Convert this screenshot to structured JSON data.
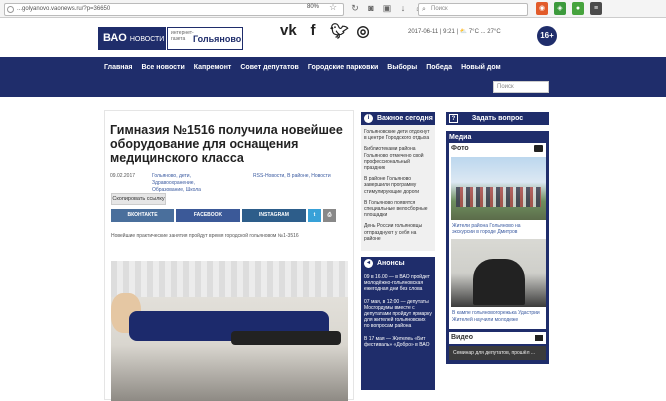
{
  "browser": {
    "url": "...golyanovo.vaonews.ru/?p=36650",
    "zoom": "80%",
    "search_placeholder": "Поиск",
    "star": "☆"
  },
  "header": {
    "logo_main": "ВАО",
    "logo_small": "НОВОСТИ",
    "logo_tiny": "интернет-газета",
    "logo_district": "Гольяново",
    "date_weather": "2017-06-11 | 9:21 | ⛅ 7°C ... 27°C",
    "age_rating": "16+"
  },
  "nav": {
    "items": [
      "Главная",
      "Все новости",
      "Капремонт",
      "Совет депутатов",
      "Городские парковки",
      "Выборы",
      "Победа",
      "Новый дом"
    ],
    "search_placeholder": "Поиск"
  },
  "article": {
    "title": "Гимназия №1516 получила новейшее оборудование для оснащения медицинского класса",
    "date": "09.02.2017",
    "tags": "Гольяново, дети, Здравоохранение, Образование, Школа",
    "links": "RSS-Новости, В районе, Новости",
    "copy_button": "Скопировать ссылку",
    "share": {
      "vk": "ВКОНТАКТЕ",
      "fb": "FACEBOOK",
      "ig": "INSTAGRAM"
    },
    "caption": "Новейшие практические занятия пройдут время городской гольяновом №1-3516"
  },
  "important": {
    "title": "Важное сегодня",
    "items": [
      "Гольяновские дети отдохнут в центре Городского отдыха",
      "Библиотеками района Гольяново отмечено свой профессиональный праздник",
      "В районе Гольяново завершили программу стимулирующие дороги",
      "В Гольяново появятся специальные велосборные площадки",
      "День России гольяновцы отпразднуют у себя на районе"
    ]
  },
  "announcements": {
    "title": "Анонсы",
    "items": [
      "09 в 16.00 — в ВАО пройдет молодёжно-гольяновская ежегодная дни без слова",
      "07 мая, в 12:00 — депутаты Мосгордумы вместе с депутатами пройдут ярмарку для жителей гольяновских по вопросам района",
      "В 17 мая — Жителеь «Бит фестиваль» «Добро» в ВАО"
    ]
  },
  "sidebar": {
    "ask_button": "Задать вопрос",
    "media_title": "Медиа",
    "photo_title": "Фото",
    "photo1_caption": "Жители района Гольяново на экскурсии в городе Дмитров",
    "photo2_caption": "В кампе гольяновогорежька Удастрии Жителей научили молодеже",
    "video_title": "Видео",
    "video_caption": "Семинар для депутатов, прошёл ..."
  }
}
